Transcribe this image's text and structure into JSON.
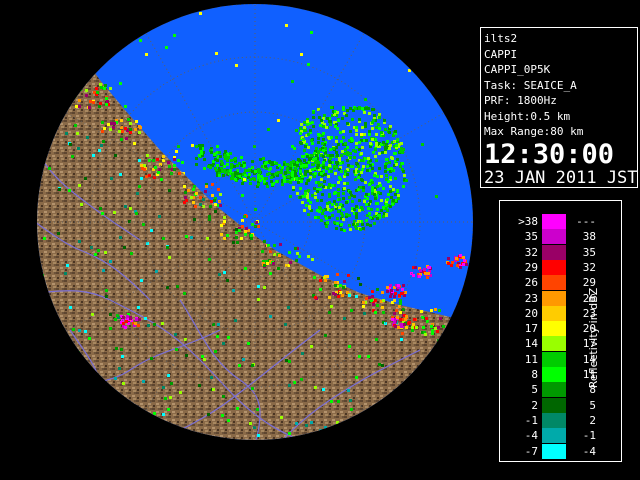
{
  "radar": {
    "colors": {
      "sea": "#1060ff",
      "outside_range": "#000000",
      "land_base": "#8a6a48",
      "river": "#7a6fd6",
      "range_ring": "#5f5f5f"
    },
    "max_range_km": 80
  },
  "info": {
    "site": "ilts2",
    "product": "CAPPI",
    "product_name": "CAPPI_0P5K",
    "task": "Task: SEAICE_A",
    "prf": "PRF: 1800Hz",
    "height": "Height:0.5 km",
    "max_range": "Max Range:80 km",
    "time": "12:30:00",
    "date": "23 JAN 2011 JST"
  },
  "legend": {
    "unit_label": "Reflectivity in dBZ",
    "rows": [
      {
        "lo": ">38",
        "hi": "---",
        "color": "#ff00ff"
      },
      {
        "lo": "35",
        "hi": "38",
        "color": "#cc00cc"
      },
      {
        "lo": "32",
        "hi": "35",
        "color": "#990066"
      },
      {
        "lo": "29",
        "hi": "32",
        "color": "#ff0000"
      },
      {
        "lo": "26",
        "hi": "29",
        "color": "#ff4400"
      },
      {
        "lo": "23",
        "hi": "26",
        "color": "#ff9900"
      },
      {
        "lo": "20",
        "hi": "23",
        "color": "#ffcc00"
      },
      {
        "lo": "17",
        "hi": "20",
        "color": "#ffff00"
      },
      {
        "lo": "14",
        "hi": "17",
        "color": "#99ff00"
      },
      {
        "lo": "11",
        "hi": "14",
        "color": "#00cc00"
      },
      {
        "lo": "8",
        "hi": "11",
        "color": "#00ff00"
      },
      {
        "lo": "5",
        "hi": "8",
        "color": "#009900"
      },
      {
        "lo": "2",
        "hi": "5",
        "color": "#006600"
      },
      {
        "lo": "-1",
        "hi": "2",
        "color": "#008866"
      },
      {
        "lo": "-4",
        "hi": "-1",
        "color": "#00aaaa"
      },
      {
        "lo": "-7",
        "hi": "-4",
        "color": "#00ffff"
      }
    ]
  }
}
